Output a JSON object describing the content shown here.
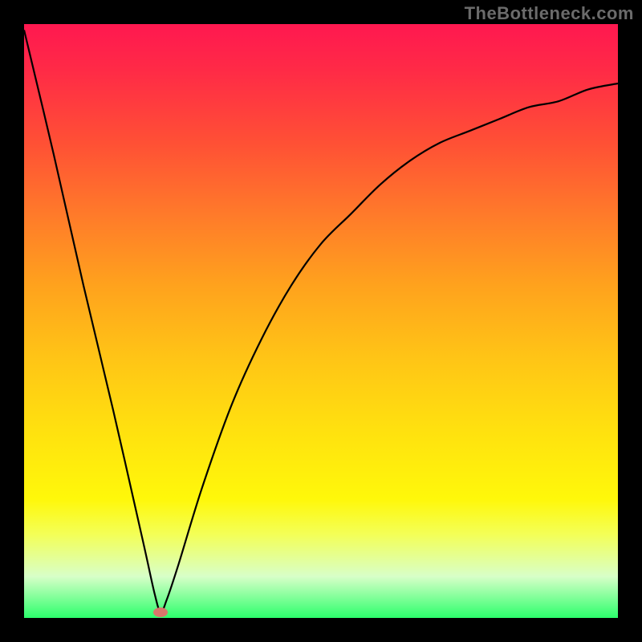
{
  "attribution": "TheBottleneck.com",
  "colors": {
    "curve_stroke": "#000000",
    "marker_fill": "#d9776b",
    "frame_border": "#000000"
  },
  "chart_data": {
    "type": "line",
    "title": "",
    "xlabel": "",
    "ylabel": "",
    "xlim": [
      0,
      100
    ],
    "ylim": [
      0,
      100
    ],
    "grid": false,
    "series_note": "Curve drops steeply from top-left, reaches near-zero at x≈23, then rises with decreasing slope toward top-right (~90% at x=100). Values are read from vertical pixel position relative to plot height; no axis tick labels are present.",
    "series": [
      {
        "name": "curve",
        "x": [
          0,
          5,
          10,
          15,
          20,
          22,
          23,
          24,
          26,
          30,
          35,
          40,
          45,
          50,
          55,
          60,
          65,
          70,
          75,
          80,
          85,
          90,
          95,
          100
        ],
        "values": [
          99,
          78,
          56,
          35,
          13,
          4,
          1,
          3,
          9,
          22,
          36,
          47,
          56,
          63,
          68,
          73,
          77,
          80,
          82,
          84,
          86,
          87,
          89,
          90
        ]
      }
    ],
    "marker": {
      "x": 23,
      "y": 1
    }
  }
}
